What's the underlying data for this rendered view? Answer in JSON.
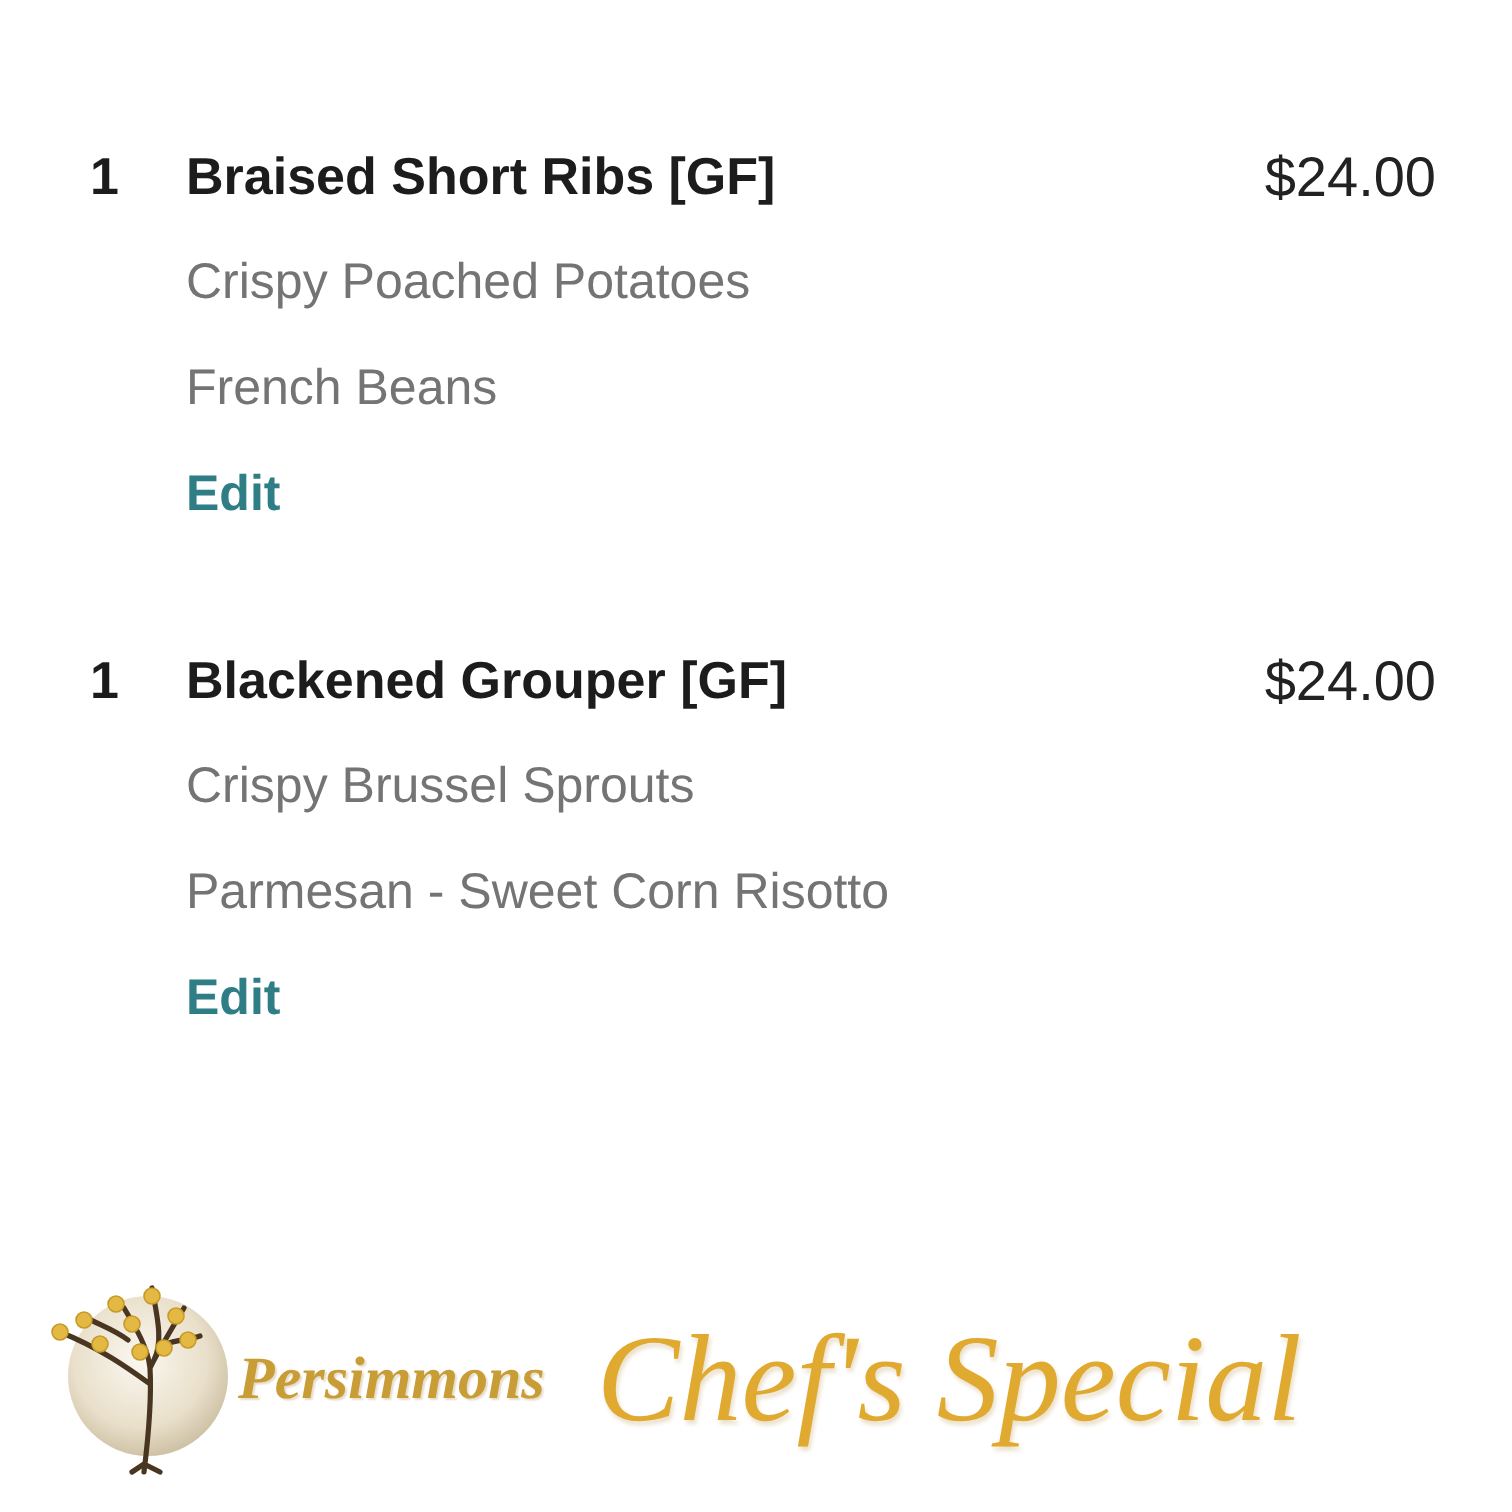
{
  "items": [
    {
      "quantity": "1",
      "name": "Braised Short Ribs [GF]",
      "price": "$24.00",
      "options": [
        "Crispy Poached Potatoes",
        "French Beans"
      ],
      "action": "Edit"
    },
    {
      "quantity": "1",
      "name": "Blackened Grouper [GF]",
      "price": "$24.00",
      "options": [
        "Crispy Brussel Sprouts",
        "Parmesan - Sweet Corn Risotto"
      ],
      "action": "Edit"
    }
  ],
  "footer": {
    "brand": "Persimmons",
    "title": "Chef's Special"
  }
}
